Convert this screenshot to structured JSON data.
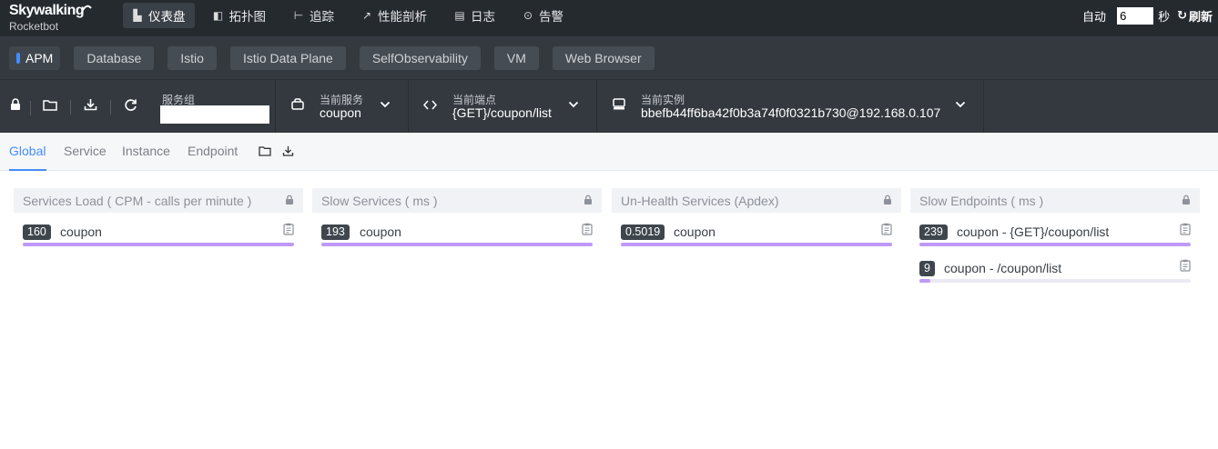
{
  "app": {
    "logo_title": "Skywalking",
    "logo_sub": "Rocketbot"
  },
  "nav": [
    {
      "label": "仪表盘",
      "icon": "chart-icon",
      "active": true
    },
    {
      "label": "拓扑图",
      "icon": "topology-icon",
      "active": false
    },
    {
      "label": "追踪",
      "icon": "trace-icon",
      "active": false
    },
    {
      "label": "性能剖析",
      "icon": "profile-icon",
      "active": false
    },
    {
      "label": "日志",
      "icon": "log-icon",
      "active": false
    },
    {
      "label": "告警",
      "icon": "alarm-icon",
      "active": false
    }
  ],
  "auto_refresh": {
    "label": "自动",
    "interval": "6",
    "unit": "秒",
    "refresh_label": "刷新"
  },
  "layers": [
    {
      "label": "APM",
      "active": true
    },
    {
      "label": "Database",
      "active": false
    },
    {
      "label": "Istio",
      "active": false
    },
    {
      "label": "Istio Data Plane",
      "active": false
    },
    {
      "label": "SelfObservability",
      "active": false
    },
    {
      "label": "VM",
      "active": false
    },
    {
      "label": "Web Browser",
      "active": false
    }
  ],
  "selectors": {
    "group": {
      "label": "服务组",
      "value": ""
    },
    "service": {
      "label": "当前服务",
      "value": "coupon"
    },
    "endpoint": {
      "label": "当前端点",
      "value": "{GET}/coupon/list"
    },
    "instance": {
      "label": "当前实例",
      "value": "bbefb44ff6ba42f0b3a74f0f0321b730@192.168.0.107"
    }
  },
  "tabs": [
    {
      "label": "Global",
      "active": true
    },
    {
      "label": "Service",
      "active": false
    },
    {
      "label": "Instance",
      "active": false
    },
    {
      "label": "Endpoint",
      "active": false
    }
  ],
  "cards": [
    {
      "title": "Services Load ( CPM - calls per minute )",
      "rows": [
        {
          "value": "160",
          "label": "coupon",
          "fill": 1.0
        }
      ]
    },
    {
      "title": "Slow Services ( ms )",
      "rows": [
        {
          "value": "193",
          "label": "coupon",
          "fill": 1.0
        }
      ]
    },
    {
      "title": "Un-Health Services (Apdex)",
      "rows": [
        {
          "value": "0.5019",
          "label": "coupon",
          "fill": 1.0
        }
      ]
    },
    {
      "title": "Slow Endpoints ( ms )",
      "rows": [
        {
          "value": "239",
          "label": "coupon - {GET}/coupon/list",
          "fill": 1.0
        },
        {
          "value": "9",
          "label": "coupon - /coupon/list",
          "fill": 0.04
        }
      ]
    }
  ],
  "colors": {
    "accent": "#448dfe",
    "bar": "#bf99f8",
    "topbar": "#252a2f",
    "toolbar": "#33393f"
  }
}
